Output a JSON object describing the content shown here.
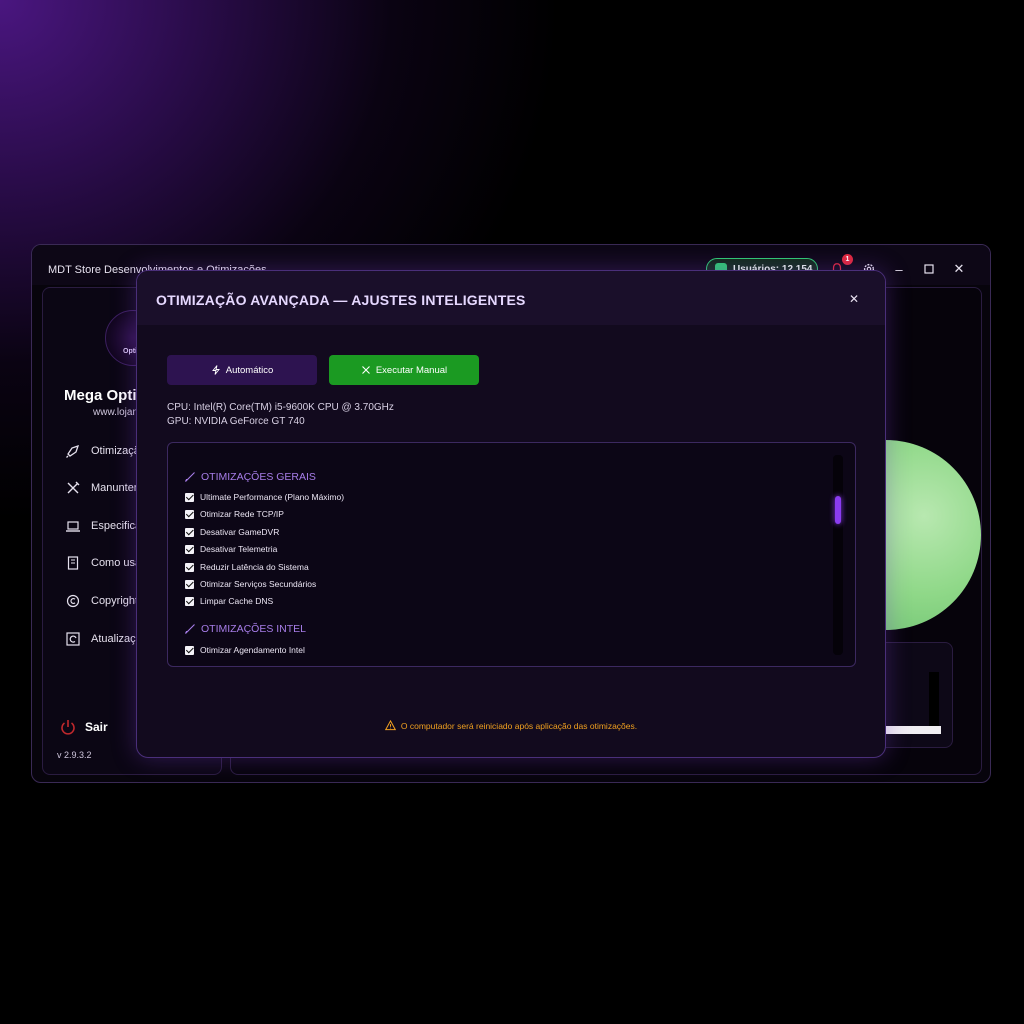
{
  "window": {
    "title": "MDT Store Desenvolvimentos e Otimizações",
    "users_label": "Usuários: 12.154",
    "notification_count": "1"
  },
  "sidebar": {
    "logo_text": "Opti",
    "brand_name": "Mega Opti",
    "brand_url": "www.lojan",
    "items": [
      {
        "label": "Otimizaçã",
        "icon": "rocket-icon"
      },
      {
        "label": "Manunten",
        "icon": "tools-icon"
      },
      {
        "label": "Especifica",
        "icon": "laptop-icon"
      },
      {
        "label": "Como usar",
        "icon": "book-icon"
      },
      {
        "label": "Copyright",
        "icon": "copyright-icon"
      },
      {
        "label": "Atualizaçã",
        "icon": "refresh-icon"
      }
    ],
    "logout_label": "Sair",
    "version": "v 2.9.3.2"
  },
  "modal": {
    "title": "OTIMIZAÇÃO AVANÇADA — AJUSTES INTELIGENTES",
    "buttons": {
      "auto": "Automático",
      "manual": "Executar Manual"
    },
    "cpu": "CPU: Intel(R) Core(TM) i5-9600K CPU @ 3.70GHz",
    "gpu": "GPU: NVIDIA GeForce GT 740",
    "sections": [
      {
        "title": "OTIMIZAÇÕES GERAIS",
        "items": [
          {
            "label": "Ultimate Performance (Plano Máximo)",
            "checked": true
          },
          {
            "label": "Otimizar Rede TCP/IP",
            "checked": true
          },
          {
            "label": "Desativar GameDVR",
            "checked": true
          },
          {
            "label": "Desativar Telemetria",
            "checked": true
          },
          {
            "label": "Reduzir Latência do Sistema",
            "checked": true
          },
          {
            "label": "Otimizar Serviços Secundários",
            "checked": true
          },
          {
            "label": "Limpar Cache DNS",
            "checked": true
          }
        ]
      },
      {
        "title": "OTIMIZAÇÕES INTEL",
        "items": [
          {
            "label": "Otimizar Agendamento Intel",
            "checked": true
          }
        ]
      }
    ],
    "warning": "O computador será reiniciado após aplicação das otimizações."
  },
  "colors": {
    "accent": "#8a3cf0",
    "manual_button": "#1b9a22",
    "auto_button": "#2d1350",
    "warning": "#f0a020",
    "users_pill": "#2ecc71"
  }
}
